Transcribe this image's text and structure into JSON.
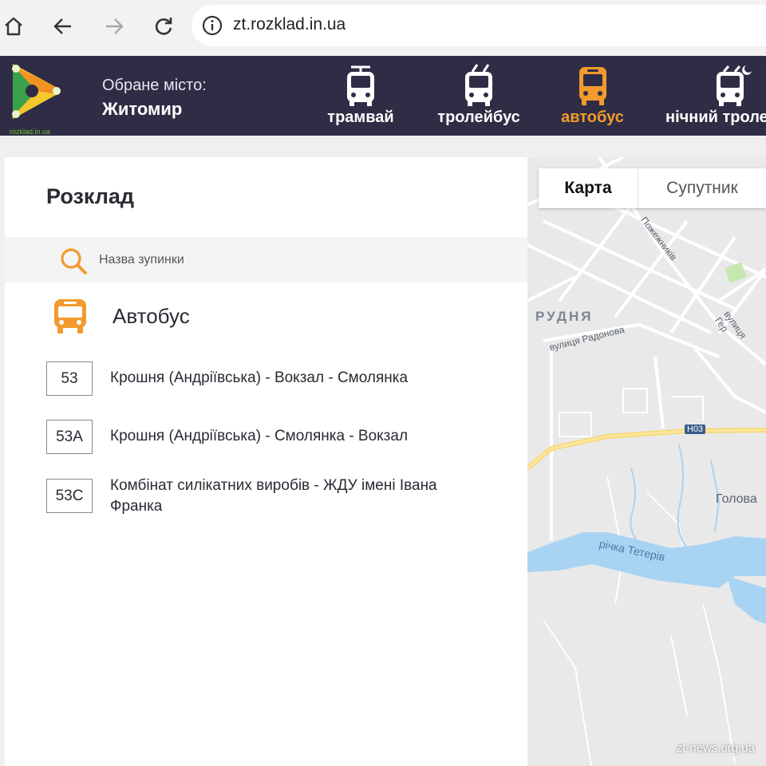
{
  "browser": {
    "url": "zt.rozklad.in.ua"
  },
  "header": {
    "logo_text": "rozklad.in.ua",
    "city_label": "Обране місто:",
    "city_name": "Житомир",
    "tabs": [
      {
        "label": "трамвай",
        "icon": "tram-icon",
        "active": false
      },
      {
        "label": "тролейбус",
        "icon": "trolleybus-icon",
        "active": false
      },
      {
        "label": "автобус",
        "icon": "bus-icon",
        "active": true
      },
      {
        "label": "нічний троле",
        "icon": "night-trolleybus-icon",
        "active": false
      }
    ]
  },
  "panel": {
    "title": "Розклад",
    "search_placeholder": "Назва зупинки",
    "section_title": "Автобус",
    "routes": [
      {
        "number": "53",
        "name": "Крошня (Андріївська) - Вокзал - Смолянка"
      },
      {
        "number": "53А",
        "name": "Крошня (Андріївська) - Смолянка - Вокзал"
      },
      {
        "number": "53С",
        "name": "Комбінат силікатних виробів - ЖДУ імені Івана Франка"
      }
    ]
  },
  "map": {
    "toggle_active": "Карта",
    "toggle_inactive": "Супутник",
    "labels": {
      "district": "РУДНЯ",
      "street_radonova": "вулиця Радонова",
      "street_pozhezhnykiv": "Пожежників",
      "street_gero": "вулиця Гер",
      "highway": "Н03",
      "river": "річка Тетерів",
      "golova": "Голова"
    }
  },
  "watermark": "zt-news.org.ua",
  "colors": {
    "header_bg": "#2f2d45",
    "accent": "#f29a2e",
    "water": "#a9d3f2"
  }
}
